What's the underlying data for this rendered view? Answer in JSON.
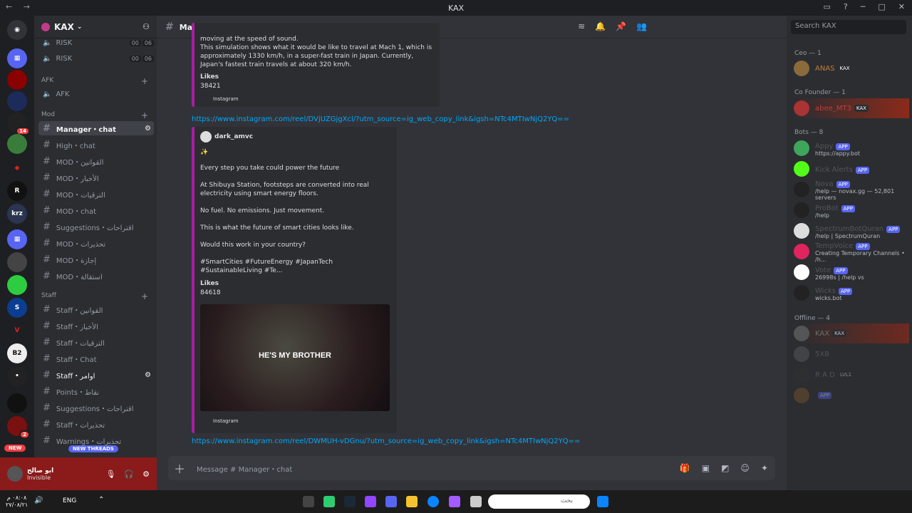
{
  "window": {
    "title": "KAX"
  },
  "guild": {
    "name": "KAX"
  },
  "channels": {
    "voice": [
      {
        "label": "RISK",
        "counts": [
          "00",
          "06"
        ]
      },
      {
        "label": "RISK",
        "counts": [
          "00",
          "06"
        ]
      }
    ],
    "afk_category": "AFK",
    "afk_channel": "AFK",
    "mod_category": "Mod",
    "mod_items": [
      {
        "label": "Manager・chat",
        "active": true
      },
      {
        "label": "High・chat"
      },
      {
        "label": "MOD・القوانين"
      },
      {
        "label": "MOD・الأخبار"
      },
      {
        "label": "MOD・الترقيات"
      },
      {
        "label": "MOD・chat"
      },
      {
        "label": "Suggestions・اقتراحات"
      },
      {
        "label": "MOD・تحذيرات"
      },
      {
        "label": "MOD・إجازة"
      },
      {
        "label": "MOD・استقالة"
      }
    ],
    "staff_category": "Staff",
    "staff_items": [
      {
        "label": "Staff・القوانين"
      },
      {
        "label": "Staff・الأخبار"
      },
      {
        "label": "Staff・الترقيات"
      },
      {
        "label": "Staff・Chat"
      },
      {
        "label": "Staff・اوامر"
      },
      {
        "label": "Points・نقاط"
      },
      {
        "label": "Suggestions・اقتراحات"
      },
      {
        "label": "Staff・تحذيرات"
      },
      {
        "label": "Warnings・تحذيرات"
      }
    ],
    "new_threads": "NEW THREADS"
  },
  "user": {
    "name": "ابو صالح",
    "status": "Invisible"
  },
  "header": {
    "channel": "Manager・chat",
    "search_placeholder": "Search KAX"
  },
  "messages": {
    "embed1": {
      "text1": "moving at the speed of sound.",
      "text2": "This simulation shows what it would be like to travel at Mach 1, which is approximately 1330 km/h, in a super-fast train in Japan. Currently, Japan's fastest train travels at about 320 km/h.",
      "likes_label": "Likes",
      "likes": "38421",
      "footer": "Instagram"
    },
    "link1": "https://www.instagram.com/reel/DVjUZGjgXcl/?utm_source=ig_web_copy_link&igsh=NTc4MTIwNjQ2YQ==",
    "embed2": {
      "author": "dark_amvc",
      "line1": "Every step you take could power the future",
      "line2": "At Shibuya Station, footsteps are converted into real electricity using smart energy floors.",
      "line3": "No fuel. No emissions. Just movement.",
      "line4": "This is what the future of smart cities looks like.",
      "line5": "Would this work in your country?",
      "line6": "#SmartCities #FutureEnergy #JapanTech #SustainableLiving #Te...",
      "likes_label": "Likes",
      "likes": "84618",
      "image_caption": "HE'S MY BROTHER",
      "footer": "Instagram"
    },
    "link2": "https://www.instagram.com/reel/DWMUH-vDGnu/?utm_source=ig_web_copy_link&igsh=NTc4MTIwNjQ2YQ==",
    "composer_placeholder": "Message # Manager・chat"
  },
  "members": {
    "groups": [
      {
        "title": "Ceo — 1",
        "members": [
          {
            "name": "ANAS",
            "tag": "KAX"
          }
        ]
      },
      {
        "title": "Co Founder — 1",
        "members": [
          {
            "name": "abee_MT3",
            "tag": "KAX"
          }
        ]
      },
      {
        "title": "Bots — 8",
        "members": [
          {
            "name": "Appy",
            "sub": "https://appy.bot"
          },
          {
            "name": "Kick Alerts",
            "sub": ""
          },
          {
            "name": "Nova",
            "sub": "/help — novax.gg — 52,801 servers"
          },
          {
            "name": "ProBot",
            "sub": "/help"
          },
          {
            "name": "SpectrumBotQuran",
            "sub": "/help | SpectrumQuran"
          },
          {
            "name": "TempVoice",
            "sub": "Creating Temporary Channels • /h..."
          },
          {
            "name": "Vote",
            "sub": "26998s | /help vs"
          },
          {
            "name": "Wicks",
            "sub": "wicks.bot"
          }
        ]
      },
      {
        "title": "Offline — 4",
        "members": [
          {
            "name": "KAX",
            "tag": "KAX"
          },
          {
            "name": "5XB",
            "tag": ""
          },
          {
            "name": "R A D",
            "tag": "LVL1"
          },
          {
            "name": "",
            "tag": "APP"
          }
        ]
      }
    ],
    "app_label": "APP"
  },
  "taskbar": {
    "time": "٠٨:٠٨ م",
    "date": "٢٧/٠٨/٢١",
    "lang": "ENG",
    "search_placeholder": "بحث"
  },
  "colors": {
    "accent": "#5865f2",
    "embed_border": "#a61f9f",
    "link": "#00a8fc"
  }
}
